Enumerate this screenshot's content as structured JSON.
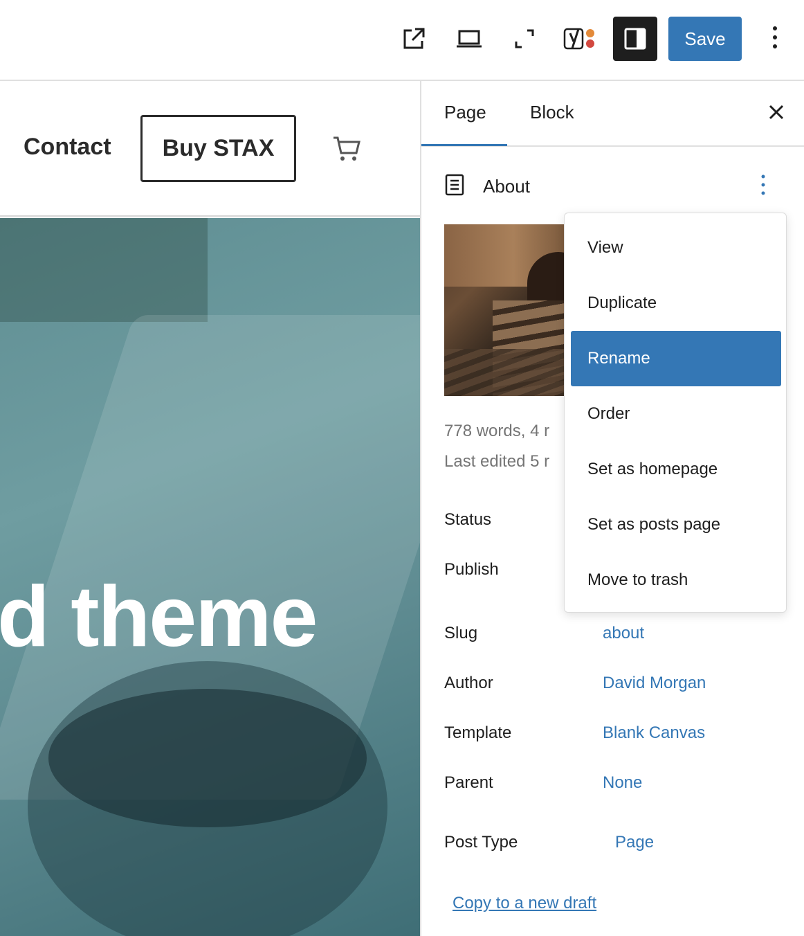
{
  "toolbar": {
    "icons": [
      "external-link-icon",
      "desktop-preview-icon",
      "fullscreen-icon",
      "yoast-seo-icon",
      "sidebar-toggle-icon",
      "more-vertical-icon"
    ],
    "save_label": "Save",
    "accent_color": "#3477b5"
  },
  "canvas": {
    "nav": {
      "contact": "Contact",
      "buy_button": "Buy STAX"
    },
    "hero_text": "d theme"
  },
  "sidebar": {
    "tabs": [
      {
        "label": "Page",
        "active": true
      },
      {
        "label": "Block",
        "active": false
      }
    ],
    "document": {
      "title": "About"
    },
    "meta": {
      "words": "778 words, 4 r",
      "edited": "Last edited 5 r"
    },
    "fields": [
      {
        "label": "Status",
        "value": ""
      },
      {
        "label": "Publish",
        "value": ""
      },
      {
        "label": "Slug",
        "value": "about"
      },
      {
        "label": "Author",
        "value": "David Morgan"
      },
      {
        "label": "Template",
        "value": "Blank Canvas"
      },
      {
        "label": "Parent",
        "value": "None"
      },
      {
        "label": "Post Type",
        "value": "Page"
      }
    ],
    "copy_link": "Copy to a new draft"
  },
  "menu": {
    "items": [
      {
        "label": "View",
        "active": false
      },
      {
        "label": "Duplicate",
        "active": false
      },
      {
        "label": "Rename",
        "active": true
      },
      {
        "label": "Order",
        "active": false
      },
      {
        "label": "Set as homepage",
        "active": false
      },
      {
        "label": "Set as posts page",
        "active": false
      },
      {
        "label": "Move to trash",
        "active": false
      }
    ]
  }
}
